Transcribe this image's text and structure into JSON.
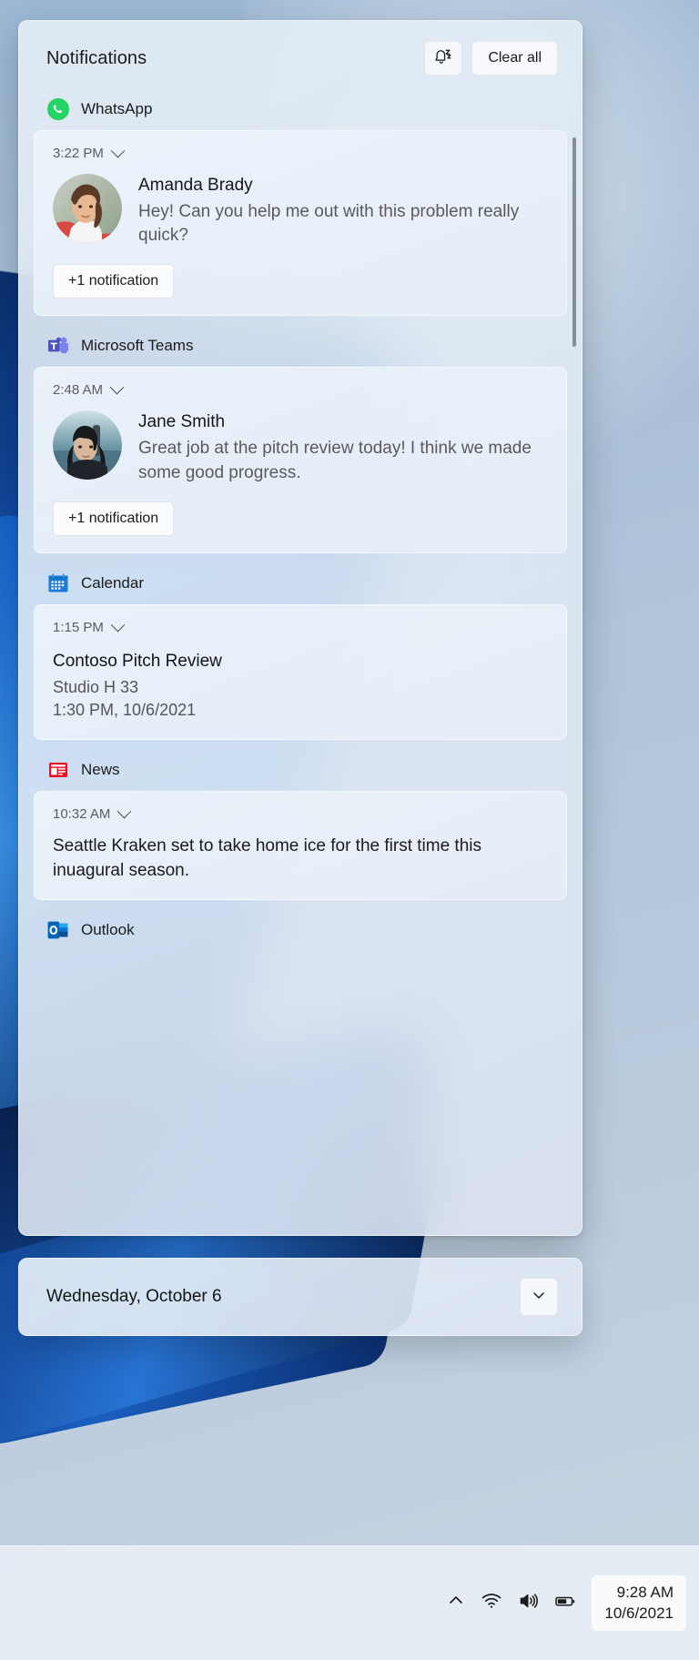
{
  "header": {
    "title": "Notifications",
    "dnd_icon": "bell-do-not-disturb-icon",
    "clear_all_label": "Clear all"
  },
  "groups": [
    {
      "app": "WhatsApp",
      "app_icon": "whatsapp-icon",
      "time": "3:22 PM",
      "sender": "Amanda Brady",
      "message": "Hey! Can you help me out with this problem really quick?",
      "more_label": "+1 notification"
    },
    {
      "app": "Microsoft Teams",
      "app_icon": "microsoft-teams-icon",
      "time": "2:48 AM",
      "sender": "Jane Smith",
      "message": "Great job at the pitch review today! I think we made some good progress.",
      "more_label": "+1 notification"
    },
    {
      "app": "Calendar",
      "app_icon": "calendar-icon",
      "time": "1:15 PM",
      "event_title": "Contoso Pitch Review",
      "event_location": "Studio H 33",
      "event_time": "1:30 PM, 10/6/2021"
    },
    {
      "app": "News",
      "app_icon": "news-icon",
      "time": "10:32 AM",
      "headline": "Seattle Kraken set to take home ice for the first time this inuagural season."
    },
    {
      "app": "Outlook",
      "app_icon": "outlook-icon"
    }
  ],
  "datebar": {
    "date": "Wednesday, October 6",
    "expand_icon": "chevron-down-icon"
  },
  "taskbar": {
    "overflow_icon": "chevron-up-icon",
    "wifi_icon": "wifi-icon",
    "volume_icon": "speaker-icon",
    "battery_icon": "battery-icon",
    "time": "9:28 AM",
    "date": "10/6/2021"
  },
  "colors": {
    "whatsapp_green": "#25D366",
    "teams_purple": "#5059C9",
    "calendar_blue": "#1E7BD6",
    "news_red": "#E81123",
    "outlook_blue": "#0F6CBD"
  }
}
